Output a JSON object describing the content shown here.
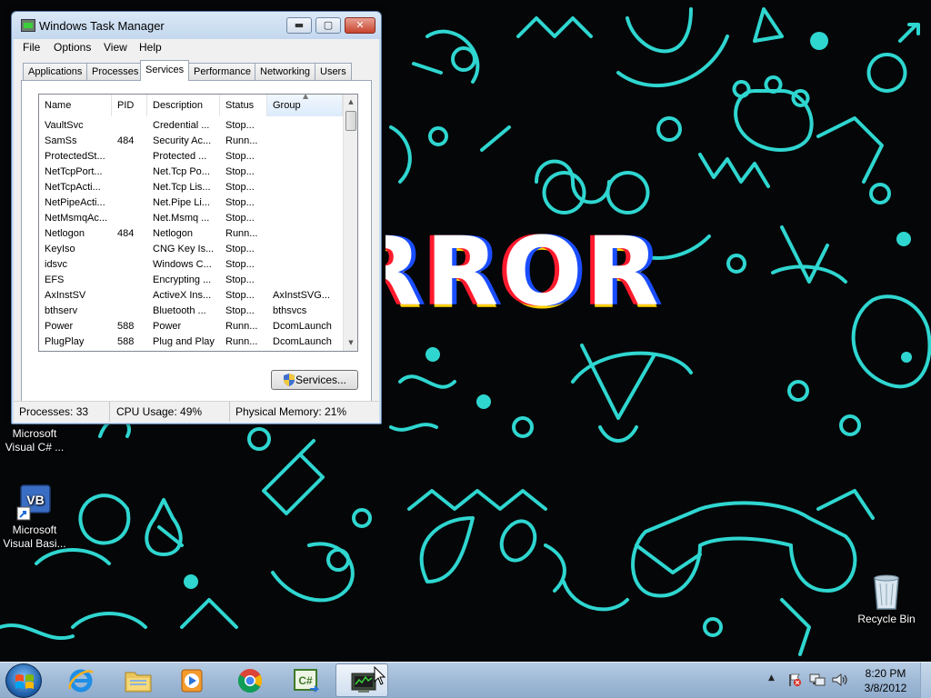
{
  "desktop": {
    "wallpaper_text": "RROR",
    "icons": [
      {
        "label_line1": "Microsoft",
        "label_line2": "Visual C# ..."
      },
      {
        "label_line1": "Microsoft",
        "label_line2": "Visual Basi..."
      },
      {
        "label_line1": "Recycle Bin",
        "label_line2": ""
      }
    ],
    "vb_badge": "VB"
  },
  "window": {
    "title": "Windows Task Manager",
    "buttons": {
      "minimize": "▬",
      "maximize": "▢",
      "close": "✕"
    },
    "menu": [
      "File",
      "Options",
      "View",
      "Help"
    ],
    "tabs": [
      "Applications",
      "Processes",
      "Services",
      "Performance",
      "Networking",
      "Users"
    ],
    "active_tab": "Services",
    "columns": [
      "Name",
      "PID",
      "Description",
      "Status",
      "Group"
    ],
    "sort_indicator": "▲",
    "rows": [
      {
        "name": "VaultSvc",
        "pid": "",
        "description": "Credential ...",
        "status": "Stop...",
        "group": ""
      },
      {
        "name": "SamSs",
        "pid": "484",
        "description": "Security Ac...",
        "status": "Runn...",
        "group": ""
      },
      {
        "name": "ProtectedSt...",
        "pid": "",
        "description": "Protected ...",
        "status": "Stop...",
        "group": ""
      },
      {
        "name": "NetTcpPort...",
        "pid": "",
        "description": "Net.Tcp Po...",
        "status": "Stop...",
        "group": ""
      },
      {
        "name": "NetTcpActi...",
        "pid": "",
        "description": "Net.Tcp Lis...",
        "status": "Stop...",
        "group": ""
      },
      {
        "name": "NetPipeActi...",
        "pid": "",
        "description": "Net.Pipe Li...",
        "status": "Stop...",
        "group": ""
      },
      {
        "name": "NetMsmqAc...",
        "pid": "",
        "description": "Net.Msmq ...",
        "status": "Stop...",
        "group": ""
      },
      {
        "name": "Netlogon",
        "pid": "484",
        "description": "Netlogon",
        "status": "Runn...",
        "group": ""
      },
      {
        "name": "KeyIso",
        "pid": "",
        "description": "CNG Key Is...",
        "status": "Stop...",
        "group": ""
      },
      {
        "name": "idsvc",
        "pid": "",
        "description": "Windows C...",
        "status": "Stop...",
        "group": ""
      },
      {
        "name": "EFS",
        "pid": "",
        "description": "Encrypting ...",
        "status": "Stop...",
        "group": ""
      },
      {
        "name": "AxInstSV",
        "pid": "",
        "description": "ActiveX Ins...",
        "status": "Stop...",
        "group": "AxInstSVG..."
      },
      {
        "name": "bthserv",
        "pid": "",
        "description": "Bluetooth ...",
        "status": "Stop...",
        "group": "bthsvcs"
      },
      {
        "name": "Power",
        "pid": "588",
        "description": "Power",
        "status": "Runn...",
        "group": "DcomLaunch"
      },
      {
        "name": "PlugPlay",
        "pid": "588",
        "description": "Plug and Play",
        "status": "Runn...",
        "group": "DcomLaunch"
      }
    ],
    "scroll": {
      "up": "▲",
      "down": "▼"
    },
    "services_button": "Services...",
    "status": {
      "processes": "Processes: 33",
      "cpu": "CPU Usage: 49%",
      "memory": "Physical Memory: 21%"
    }
  },
  "taskbar": {
    "apps": [
      "internet-explorer",
      "windows-explorer",
      "media-player",
      "chrome",
      "visual-csharp",
      "task-manager"
    ],
    "tray_chevron": "▲",
    "clock": {
      "time": "8:20 PM",
      "date": "3/8/2012"
    }
  },
  "colors": {
    "wallpaper_accent": "#2fd6d0",
    "wallpaper_bg": "#050608",
    "taskbar": "#a9c2dd",
    "window_frame": "#c9dcf1",
    "close_button": "#c8442d"
  }
}
